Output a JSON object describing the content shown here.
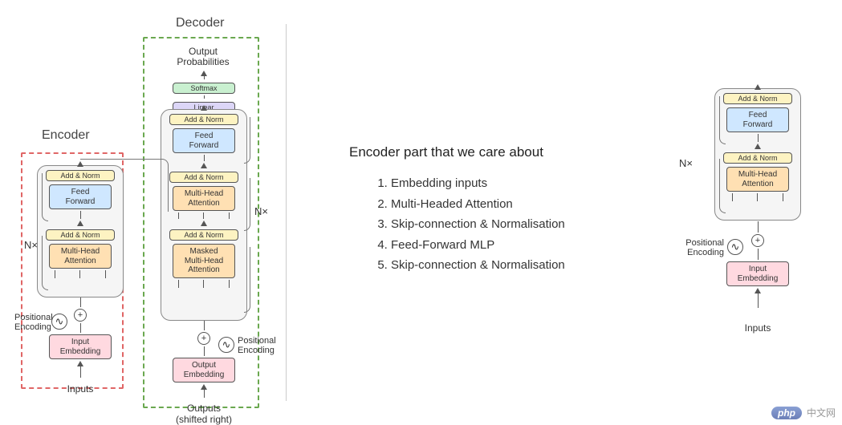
{
  "titles": {
    "encoder": "Encoder",
    "decoder": "Decoder"
  },
  "blocks": {
    "add_norm": "Add & Norm",
    "feed_forward": "Feed\nForward",
    "multi_head_attention": "Multi-Head\nAttention",
    "masked_multi_head_attention": "Masked\nMulti-Head\nAttention",
    "input_embedding": "Input\nEmbedding",
    "output_embedding": "Output\nEmbedding",
    "softmax": "Softmax",
    "linear": "Linear"
  },
  "labels": {
    "positional_encoding": "Positional\nEncoding",
    "nx": "N×",
    "inputs": "Inputs",
    "outputs_shifted": "Outputs\n(shifted right)",
    "output_probabilities": "Output\nProbabilities"
  },
  "middle": {
    "heading": "Encoder part that we care about",
    "items": [
      "Embedding inputs",
      "Multi-Headed Attention",
      "Skip-connection & Normalisation",
      "Feed-Forward MLP",
      "Skip-connection & Normalisation"
    ]
  },
  "colors": {
    "encoder_dash": "#e06666",
    "decoder_dash": "#6aa84f",
    "addnorm_bg": "#fdf3c2",
    "feed_bg": "#cfe7ff",
    "attn_bg": "#ffe0b3",
    "embed_bg": "#ffd9e0",
    "softmax_bg": "#c9f0d0",
    "linear_bg": "#dcd6f7"
  },
  "watermark": {
    "badge": "php",
    "text": "中文网"
  }
}
